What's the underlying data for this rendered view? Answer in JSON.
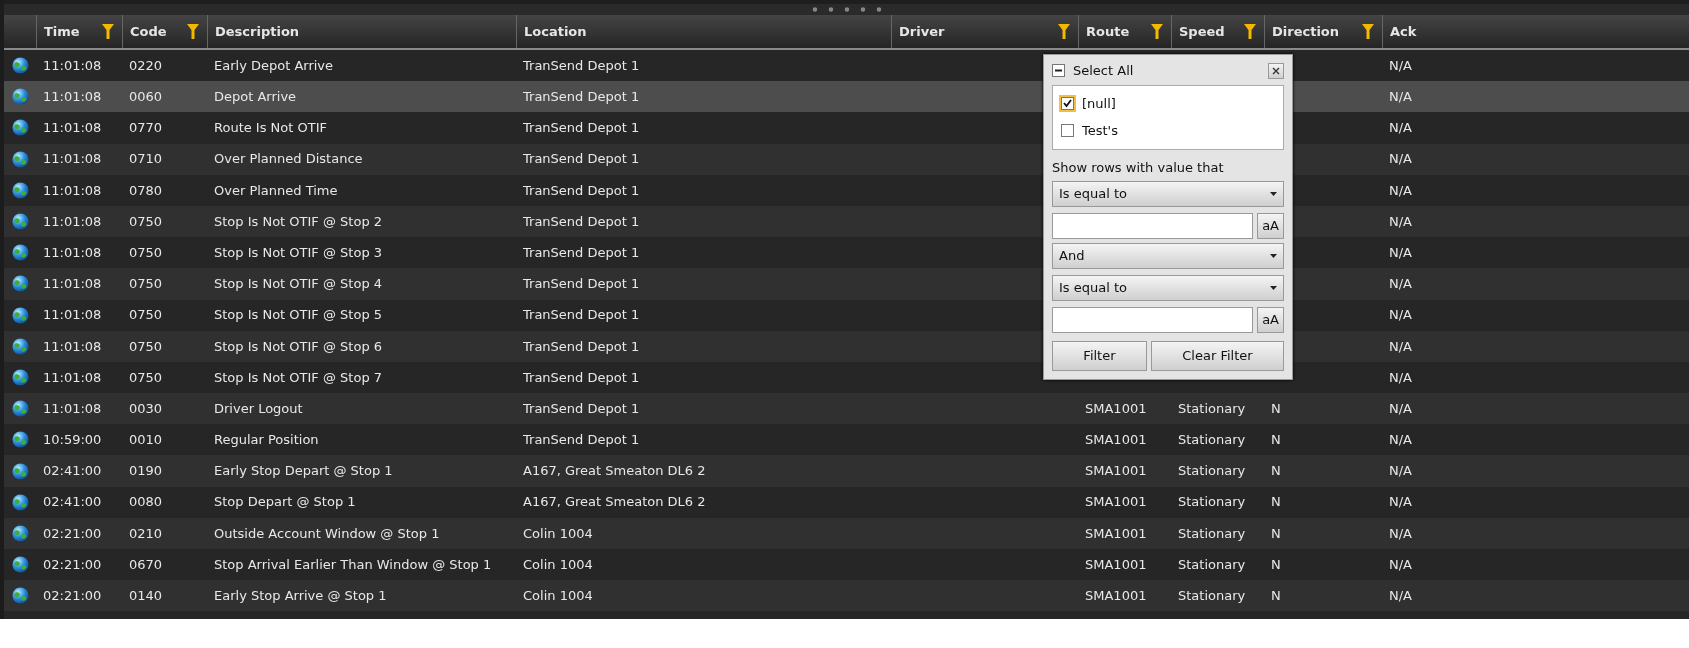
{
  "columns": [
    {
      "filter_icon": false
    },
    {
      "label": "Time",
      "filter_icon": true
    },
    {
      "label": "Code",
      "filter_icon": true
    },
    {
      "label": "Description",
      "filter_icon": false
    },
    {
      "label": "Location",
      "filter_icon": false
    },
    {
      "label": "Driver",
      "filter_icon": true
    },
    {
      "label": "Route",
      "filter_icon": true
    },
    {
      "label": "Speed",
      "filter_icon": true
    },
    {
      "label": "Direction",
      "filter_icon": true
    },
    {
      "label": "Ack",
      "filter_icon": false
    }
  ],
  "rows": [
    {
      "selected": false,
      "time": "11:01:08",
      "code": "0220",
      "description": "Early Depot Arrive",
      "location": "TranSend Depot 1",
      "ack": "N/A"
    },
    {
      "selected": true,
      "time": "11:01:08",
      "code": "0060",
      "description": "Depot Arrive",
      "location": "TranSend Depot 1",
      "ack": "N/A"
    },
    {
      "selected": false,
      "time": "11:01:08",
      "code": "0770",
      "description": "Route Is Not OTIF",
      "location": "TranSend Depot 1",
      "ack": "N/A"
    },
    {
      "selected": false,
      "time": "11:01:08",
      "code": "0710",
      "description": "Over Planned Distance",
      "location": "TranSend Depot 1",
      "ack": "N/A"
    },
    {
      "selected": false,
      "time": "11:01:08",
      "code": "0780",
      "description": "Over Planned Time",
      "location": "TranSend Depot 1",
      "ack": "N/A"
    },
    {
      "selected": false,
      "time": "11:01:08",
      "code": "0750",
      "description": "Stop Is Not OTIF @ Stop 2",
      "location": "TranSend Depot 1",
      "ack": "N/A"
    },
    {
      "selected": false,
      "time": "11:01:08",
      "code": "0750",
      "description": "Stop Is Not OTIF @ Stop 3",
      "location": "TranSend Depot 1",
      "ack": "N/A"
    },
    {
      "selected": false,
      "time": "11:01:08",
      "code": "0750",
      "description": "Stop Is Not OTIF @ Stop 4",
      "location": "TranSend Depot 1",
      "ack": "N/A"
    },
    {
      "selected": false,
      "time": "11:01:08",
      "code": "0750",
      "description": "Stop Is Not OTIF @ Stop 5",
      "location": "TranSend Depot 1",
      "ack": "N/A"
    },
    {
      "selected": false,
      "time": "11:01:08",
      "code": "0750",
      "description": "Stop Is Not OTIF @ Stop 6",
      "location": "TranSend Depot 1",
      "ack": "N/A"
    },
    {
      "selected": false,
      "time": "11:01:08",
      "code": "0750",
      "description": "Stop Is Not OTIF @ Stop 7",
      "location": "TranSend Depot 1",
      "ack": "N/A"
    },
    {
      "selected": false,
      "time": "11:01:08",
      "code": "0030",
      "description": "Driver Logout",
      "location": "TranSend Depot 1",
      "route": "SMA1001",
      "speed": "Stationary",
      "direction": "N",
      "ack": "N/A"
    },
    {
      "selected": false,
      "time": "10:59:00",
      "code": "0010",
      "description": "Regular Position",
      "location": "TranSend Depot 1",
      "route": "SMA1001",
      "speed": "Stationary",
      "direction": "N",
      "ack": "N/A"
    },
    {
      "selected": false,
      "time": "02:41:00",
      "code": "0190",
      "description": "Early Stop Depart @ Stop 1",
      "location": "A167, Great Smeaton DL6 2",
      "route": "SMA1001",
      "speed": "Stationary",
      "direction": "N",
      "ack": "N/A"
    },
    {
      "selected": false,
      "time": "02:41:00",
      "code": "0080",
      "description": "Stop Depart @ Stop 1",
      "location": "A167, Great Smeaton DL6 2",
      "route": "SMA1001",
      "speed": "Stationary",
      "direction": "N",
      "ack": "N/A"
    },
    {
      "selected": false,
      "time": "02:21:00",
      "code": "0210",
      "description": "Outside Account Window @ Stop 1",
      "location": "Colin 1004",
      "route": "SMA1001",
      "speed": "Stationary",
      "direction": "N",
      "ack": "N/A"
    },
    {
      "selected": false,
      "time": "02:21:00",
      "code": "0670",
      "description": "Stop Arrival Earlier Than Window @ Stop 1",
      "location": "Colin 1004",
      "route": "SMA1001",
      "speed": "Stationary",
      "direction": "N",
      "ack": "N/A"
    },
    {
      "selected": false,
      "time": "02:21:00",
      "code": "0140",
      "description": "Early Stop Arrive @ Stop 1",
      "location": "Colin 1004",
      "route": "SMA1001",
      "speed": "Stationary",
      "direction": "N",
      "ack": "N/A"
    }
  ],
  "filter_popup": {
    "select_all": {
      "label": "Select All",
      "indeterminate": true
    },
    "values": [
      {
        "label": "[null]",
        "checked": true
      },
      {
        "label": "Test's",
        "checked": false
      }
    ],
    "prompt": "Show rows with value that",
    "operator_1": "Is equal to",
    "case_button_1": "aA",
    "logic": "And",
    "operator_2": "Is equal to",
    "case_button_2": "aA",
    "buttons": [
      "Filter",
      "Clear Filter"
    ]
  }
}
